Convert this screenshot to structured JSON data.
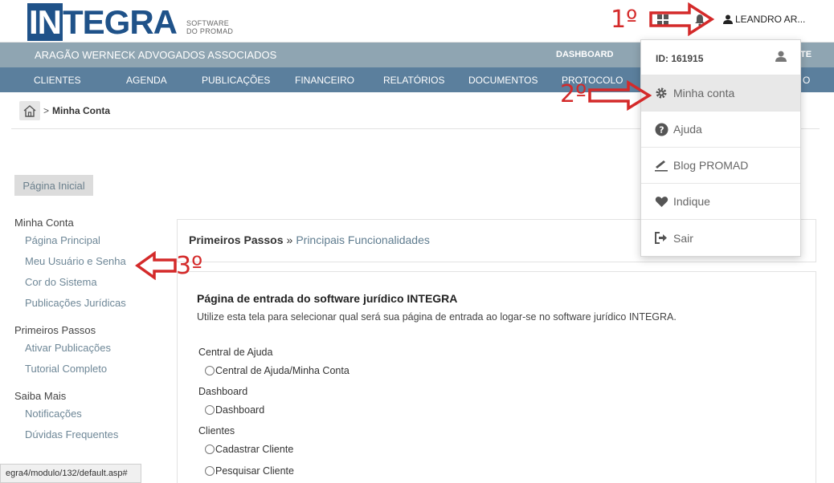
{
  "topbar": {
    "logo_text": "INTEGRA",
    "logo_sub_line1": "SOFTWARE",
    "logo_sub_line2": "DO PROMAD",
    "user_name": "LEANDRO AR..."
  },
  "firm_bar": {
    "firm_name": "ARAGÃO WERNECK ADVOGADOS ASSOCIADOS",
    "dashboard": "DASHBOARD",
    "right_fragment": "TE"
  },
  "nav": {
    "items": [
      "CLIENTES",
      "AGENDA",
      "PUBLICAÇÕES",
      "FINANCEIRO",
      "RELATÓRIOS",
      "DOCUMENTOS",
      "PROTOCOLO",
      "O"
    ]
  },
  "breadcrumb": {
    "separator": ">",
    "current": "Minha Conta"
  },
  "home_button": "Página Inicial",
  "sidebar": {
    "groups": [
      {
        "title": "Minha Conta",
        "links": [
          "Página Principal",
          "Meu Usuário e Senha",
          "Cor do Sistema",
          "Publicações Jurídicas"
        ]
      },
      {
        "title": "Primeiros Passos",
        "links": [
          "Ativar Publicações",
          "Tutorial Completo"
        ]
      },
      {
        "title": "Saiba Mais",
        "links": [
          "Notificações",
          "Dúvidas Frequentes"
        ]
      }
    ]
  },
  "card1": {
    "title": "Primeiros Passos",
    "separator": "»",
    "subtitle": "Principais Funcionalidades"
  },
  "card2": {
    "title": "Página de entrada do software jurídico INTEGRA",
    "description": "Utilize esta tela para selecionar qual será sua página de entrada ao logar-se no software jurídico INTEGRA.",
    "groups": [
      {
        "label": "Central de Ajuda",
        "options": [
          "Central de Ajuda/Minha Conta"
        ]
      },
      {
        "label": "Dashboard",
        "options": [
          "Dashboard"
        ]
      },
      {
        "label": "Clientes",
        "options": [
          "Cadastrar Cliente",
          "Pesquisar Cliente"
        ]
      }
    ]
  },
  "dropdown": {
    "id_label": "ID: 161915",
    "items": [
      "Minha conta",
      "Ajuda",
      "Blog PROMAD",
      "Indique",
      "Sair"
    ]
  },
  "annotations": {
    "step1": "1º",
    "step2": "2º",
    "step3": "3º"
  },
  "status_bar": "egra4/modulo/132/default.asp#",
  "colors": {
    "brand_blue": "#1f5289",
    "firm_bar": "#8fa5b2",
    "nav_bar": "#5b7f9d",
    "annotation_red": "#d42a2a"
  }
}
